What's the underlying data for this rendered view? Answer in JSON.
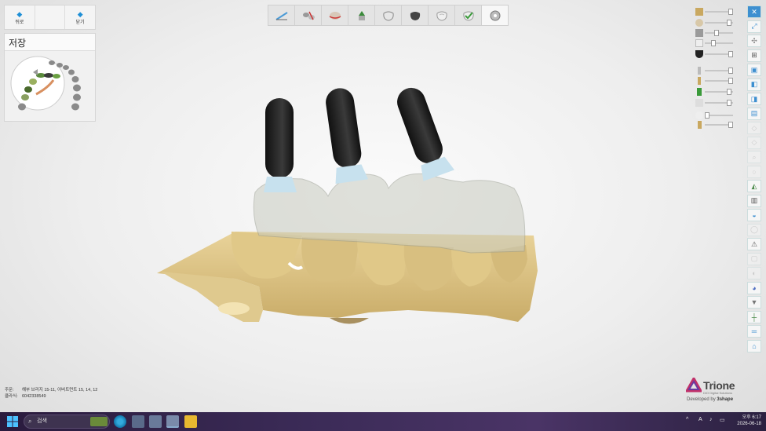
{
  "nav": {
    "back_label": "뒤로",
    "close_label": "닫기"
  },
  "save_panel": {
    "title": "저장"
  },
  "toolbar": {
    "tools": [
      "scan-tool-icon",
      "cut-tool-icon",
      "margin-tool-icon",
      "abutment-tool-icon",
      "crown-tool-icon",
      "anatomy-tool-icon",
      "crown-shell-tool-icon",
      "check-tool-icon",
      "finish-tool-icon"
    ]
  },
  "order_info": {
    "order_label": "주문:",
    "order_value": "해부 브리지 15-11, 어버트먼트 15, 14, 12",
    "client_label": "클라식:",
    "client_value": "6042338549"
  },
  "logo": {
    "name": "Trione",
    "sub": "DIO Digital Solutions",
    "developed_by": "Developed by",
    "brand": "3shape"
  },
  "taskbar": {
    "search_placeholder": "검색",
    "time": "오후 6:17",
    "date": "2026-06-18",
    "ime": "A"
  },
  "colors": {
    "accent": "#1e8fd6",
    "model_gold": "#e8d49a",
    "abutment_black": "#1d1d1d",
    "crown_translucent": "#c9ccc0"
  }
}
